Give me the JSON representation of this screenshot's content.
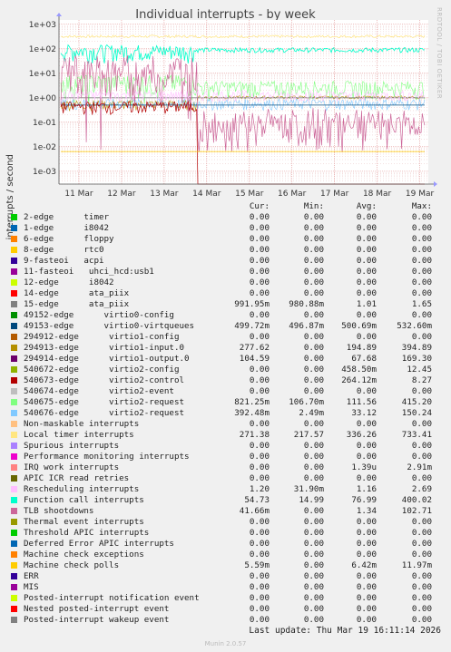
{
  "title": "Individual interrupts - by week",
  "rrd_credit": "RRDTOOL / TOBI OETIKER",
  "ylabel": "interrupts / second",
  "columns": [
    "Cur:",
    "Min:",
    "Avg:",
    "Max:"
  ],
  "last_update": "Last update: Thu Mar 19 16:11:14 2026",
  "munin_version": "Munin 2.0.57",
  "colors": {
    "background": "#f0f0f0",
    "plot_bg": "#ffffff",
    "grid_major": "#e09090",
    "grid_minor": "#e8c0c0"
  },
  "chart_data": {
    "type": "line",
    "y_scale": "log",
    "ylim": [
      0.0003,
      1500
    ],
    "y_ticks": [
      "1e+03",
      "1e+02",
      "1e+01",
      "1e+00",
      "1e-01",
      "1e-02",
      "1e-03"
    ],
    "x_ticks": [
      "11 Mar",
      "12 Mar",
      "13 Mar",
      "14 Mar",
      "15 Mar",
      "16 Mar",
      "17 Mar",
      "18 Mar",
      "19 Mar"
    ],
    "grid": true,
    "series": [
      {
        "name": "2-edge      timer",
        "color": "#00cc00",
        "cur": "0.00",
        "min": "0.00",
        "avg": "0.00",
        "max": "0.00"
      },
      {
        "name": "1-edge      i8042",
        "color": "#0066b3",
        "cur": "0.00",
        "min": "0.00",
        "avg": "0.00",
        "max": "0.00"
      },
      {
        "name": "6-edge      floppy",
        "color": "#ff8000",
        "cur": "0.00",
        "min": "0.00",
        "avg": "0.00",
        "max": "0.00"
      },
      {
        "name": "8-edge      rtc0",
        "color": "#ffcc00",
        "cur": "0.00",
        "min": "0.00",
        "avg": "0.00",
        "max": "0.00"
      },
      {
        "name": "9-fasteoi   acpi",
        "color": "#330099",
        "cur": "0.00",
        "min": "0.00",
        "avg": "0.00",
        "max": "0.00"
      },
      {
        "name": "11-fasteoi   uhci_hcd:usb1",
        "color": "#990099",
        "cur": "0.00",
        "min": "0.00",
        "avg": "0.00",
        "max": "0.00"
      },
      {
        "name": "12-edge      i8042",
        "color": "#ccff00",
        "cur": "0.00",
        "min": "0.00",
        "avg": "0.00",
        "max": "0.00"
      },
      {
        "name": "14-edge      ata_piix",
        "color": "#ff0000",
        "cur": "0.00",
        "min": "0.00",
        "avg": "0.00",
        "max": "0.00"
      },
      {
        "name": "15-edge      ata_piix",
        "color": "#808080",
        "cur": "991.95m",
        "min": "980.88m",
        "avg": "1.01",
        "max": "1.65"
      },
      {
        "name": "49152-edge      virtio0-config",
        "color": "#008f00",
        "cur": "0.00",
        "min": "0.00",
        "avg": "0.00",
        "max": "0.00"
      },
      {
        "name": "49153-edge      virtio0-virtqueues",
        "color": "#00487d",
        "cur": "499.72m",
        "min": "496.87m",
        "avg": "500.69m",
        "max": "532.60m"
      },
      {
        "name": "294912-edge      virtio1-config",
        "color": "#b35a00",
        "cur": "0.00",
        "min": "0.00",
        "avg": "0.00",
        "max": "0.00"
      },
      {
        "name": "294913-edge      virtio1-input.0",
        "color": "#b38f00",
        "cur": "277.62",
        "min": "0.00",
        "avg": "194.89",
        "max": "394.89"
      },
      {
        "name": "294914-edge      virtio1-output.0",
        "color": "#6b006b",
        "cur": "104.59",
        "min": "0.00",
        "avg": "67.68",
        "max": "169.30"
      },
      {
        "name": "540672-edge      virtio2-config",
        "color": "#8fb300",
        "cur": "0.00",
        "min": "0.00",
        "avg": "458.50m",
        "max": "12.45"
      },
      {
        "name": "540673-edge      virtio2-control",
        "color": "#b30000",
        "cur": "0.00",
        "min": "0.00",
        "avg": "264.12m",
        "max": "8.27"
      },
      {
        "name": "540674-edge      virtio2-event",
        "color": "#bebebe",
        "cur": "0.00",
        "min": "0.00",
        "avg": "0.00",
        "max": "0.00"
      },
      {
        "name": "540675-edge      virtio2-request",
        "color": "#80ff80",
        "cur": "821.25m",
        "min": "106.70m",
        "avg": "111.56",
        "max": "415.20"
      },
      {
        "name": "540676-edge      virtio2-request",
        "color": "#80c9ff",
        "cur": "392.48m",
        "min": "2.49m",
        "avg": "33.12",
        "max": "150.24"
      },
      {
        "name": "Non-maskable interrupts",
        "color": "#ffc080",
        "cur": "0.00",
        "min": "0.00",
        "avg": "0.00",
        "max": "0.00"
      },
      {
        "name": "Local timer interrupts",
        "color": "#ffe680",
        "cur": "271.38",
        "min": "217.57",
        "avg": "336.26",
        "max": "733.41"
      },
      {
        "name": "Spurious interrupts",
        "color": "#aa80ff",
        "cur": "0.00",
        "min": "0.00",
        "avg": "0.00",
        "max": "0.00"
      },
      {
        "name": "Performance monitoring interrupts",
        "color": "#ee00cc",
        "cur": "0.00",
        "min": "0.00",
        "avg": "0.00",
        "max": "0.00"
      },
      {
        "name": "IRQ work interrupts",
        "color": "#ff8080",
        "cur": "0.00",
        "min": "0.00",
        "avg": "1.39u",
        "max": "2.91m"
      },
      {
        "name": "APIC ICR read retries",
        "color": "#666600",
        "cur": "0.00",
        "min": "0.00",
        "avg": "0.00",
        "max": "0.00"
      },
      {
        "name": "Rescheduling interrupts",
        "color": "#ffbfff",
        "cur": "1.20",
        "min": "31.90m",
        "avg": "1.16",
        "max": "2.69"
      },
      {
        "name": "Function call interrupts",
        "color": "#00ffcc",
        "cur": "54.73",
        "min": "14.99",
        "avg": "76.99",
        "max": "400.02"
      },
      {
        "name": "TLB shootdowns",
        "color": "#cc6699",
        "cur": "41.66m",
        "min": "0.00",
        "avg": "1.34",
        "max": "102.71"
      },
      {
        "name": "Thermal event interrupts",
        "color": "#999900",
        "cur": "0.00",
        "min": "0.00",
        "avg": "0.00",
        "max": "0.00"
      },
      {
        "name": "Threshold APIC interrupts",
        "color": "#00cc00",
        "cur": "0.00",
        "min": "0.00",
        "avg": "0.00",
        "max": "0.00"
      },
      {
        "name": "Deferred Error APIC interrupts",
        "color": "#0066b3",
        "cur": "0.00",
        "min": "0.00",
        "avg": "0.00",
        "max": "0.00"
      },
      {
        "name": "Machine check exceptions",
        "color": "#ff8000",
        "cur": "0.00",
        "min": "0.00",
        "avg": "0.00",
        "max": "0.00"
      },
      {
        "name": "Machine check polls",
        "color": "#ffcc00",
        "cur": "5.59m",
        "min": "0.00",
        "avg": "6.42m",
        "max": "11.97m"
      },
      {
        "name": "ERR",
        "color": "#330099",
        "cur": "0.00",
        "min": "0.00",
        "avg": "0.00",
        "max": "0.00"
      },
      {
        "name": "MIS",
        "color": "#990099",
        "cur": "0.00",
        "min": "0.00",
        "avg": "0.00",
        "max": "0.00"
      },
      {
        "name": "Posted-interrupt notification event",
        "color": "#ccff00",
        "cur": "0.00",
        "min": "0.00",
        "avg": "0.00",
        "max": "0.00"
      },
      {
        "name": "Nested posted-interrupt event",
        "color": "#ff0000",
        "cur": "0.00",
        "min": "0.00",
        "avg": "0.00",
        "max": "0.00"
      },
      {
        "name": "Posted-interrupt wakeup event",
        "color": "#808080",
        "cur": "0.00",
        "min": "0.00",
        "avg": "0.00",
        "max": "0.00"
      }
    ]
  }
}
